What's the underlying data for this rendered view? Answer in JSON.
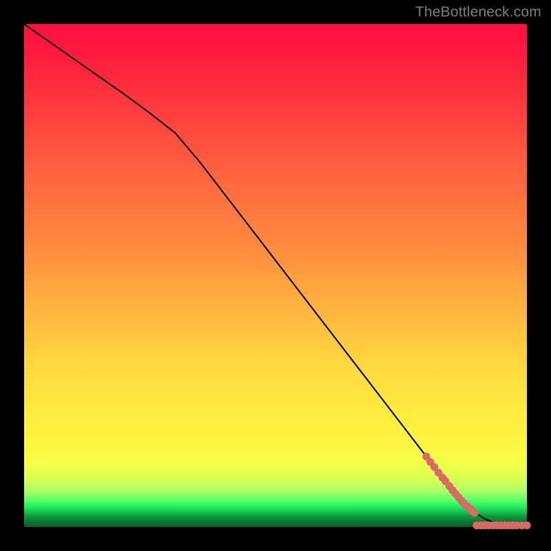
{
  "watermark": "TheBottleneck.com",
  "colors": {
    "gradient_top": "#ff1040",
    "gradient_mid": "#ffe93f",
    "gradient_bottom": "#086028",
    "line": "#000000",
    "dots": "#d86b63",
    "frame": "#000000"
  },
  "chart_data": {
    "type": "line",
    "title": "",
    "xlabel": "",
    "ylabel": "",
    "xlim": [
      0,
      100
    ],
    "ylim": [
      0,
      100
    ],
    "grid": false,
    "series": [
      {
        "name": "curve",
        "x": [
          0,
          5,
          10,
          15,
          20,
          25,
          30,
          35,
          40,
          45,
          50,
          55,
          60,
          65,
          70,
          75,
          80,
          82,
          84,
          86,
          88,
          90,
          92,
          94,
          96,
          98,
          100
        ],
        "y": [
          100,
          96.5,
          93.0,
          89.5,
          86.0,
          82.3,
          78.4,
          72.5,
          66.0,
          59.5,
          53.0,
          46.5,
          40.0,
          33.5,
          27.0,
          20.5,
          14.0,
          11.4,
          8.8,
          6.3,
          4.2,
          2.6,
          1.4,
          0.7,
          0.35,
          0.2,
          0.2
        ]
      }
    ],
    "scatter": [
      {
        "x": 80.0,
        "y": 14.0
      },
      {
        "x": 80.8,
        "y": 12.9
      },
      {
        "x": 81.6,
        "y": 11.9
      },
      {
        "x": 82.4,
        "y": 10.8
      },
      {
        "x": 83.2,
        "y": 9.8
      },
      {
        "x": 83.8,
        "y": 9.1
      },
      {
        "x": 84.6,
        "y": 8.1
      },
      {
        "x": 85.2,
        "y": 7.3
      },
      {
        "x": 85.8,
        "y": 6.6
      },
      {
        "x": 86.4,
        "y": 5.9
      },
      {
        "x": 87.0,
        "y": 5.2
      },
      {
        "x": 87.5,
        "y": 4.7
      },
      {
        "x": 88.0,
        "y": 4.2
      },
      {
        "x": 88.4,
        "y": 3.8
      },
      {
        "x": 88.8,
        "y": 3.5
      },
      {
        "x": 89.2,
        "y": 3.1
      },
      {
        "x": 89.6,
        "y": 2.8
      },
      {
        "x": 90.0,
        "y": 0.3
      },
      {
        "x": 90.8,
        "y": 0.3
      },
      {
        "x": 91.6,
        "y": 0.3
      },
      {
        "x": 92.4,
        "y": 0.3
      },
      {
        "x": 93.2,
        "y": 0.3
      },
      {
        "x": 94.0,
        "y": 0.3
      },
      {
        "x": 94.8,
        "y": 0.3
      },
      {
        "x": 95.6,
        "y": 0.3
      },
      {
        "x": 96.4,
        "y": 0.3
      },
      {
        "x": 97.2,
        "y": 0.3
      },
      {
        "x": 98.0,
        "y": 0.3
      },
      {
        "x": 99.0,
        "y": 0.3
      },
      {
        "x": 100.0,
        "y": 0.3
      }
    ]
  }
}
